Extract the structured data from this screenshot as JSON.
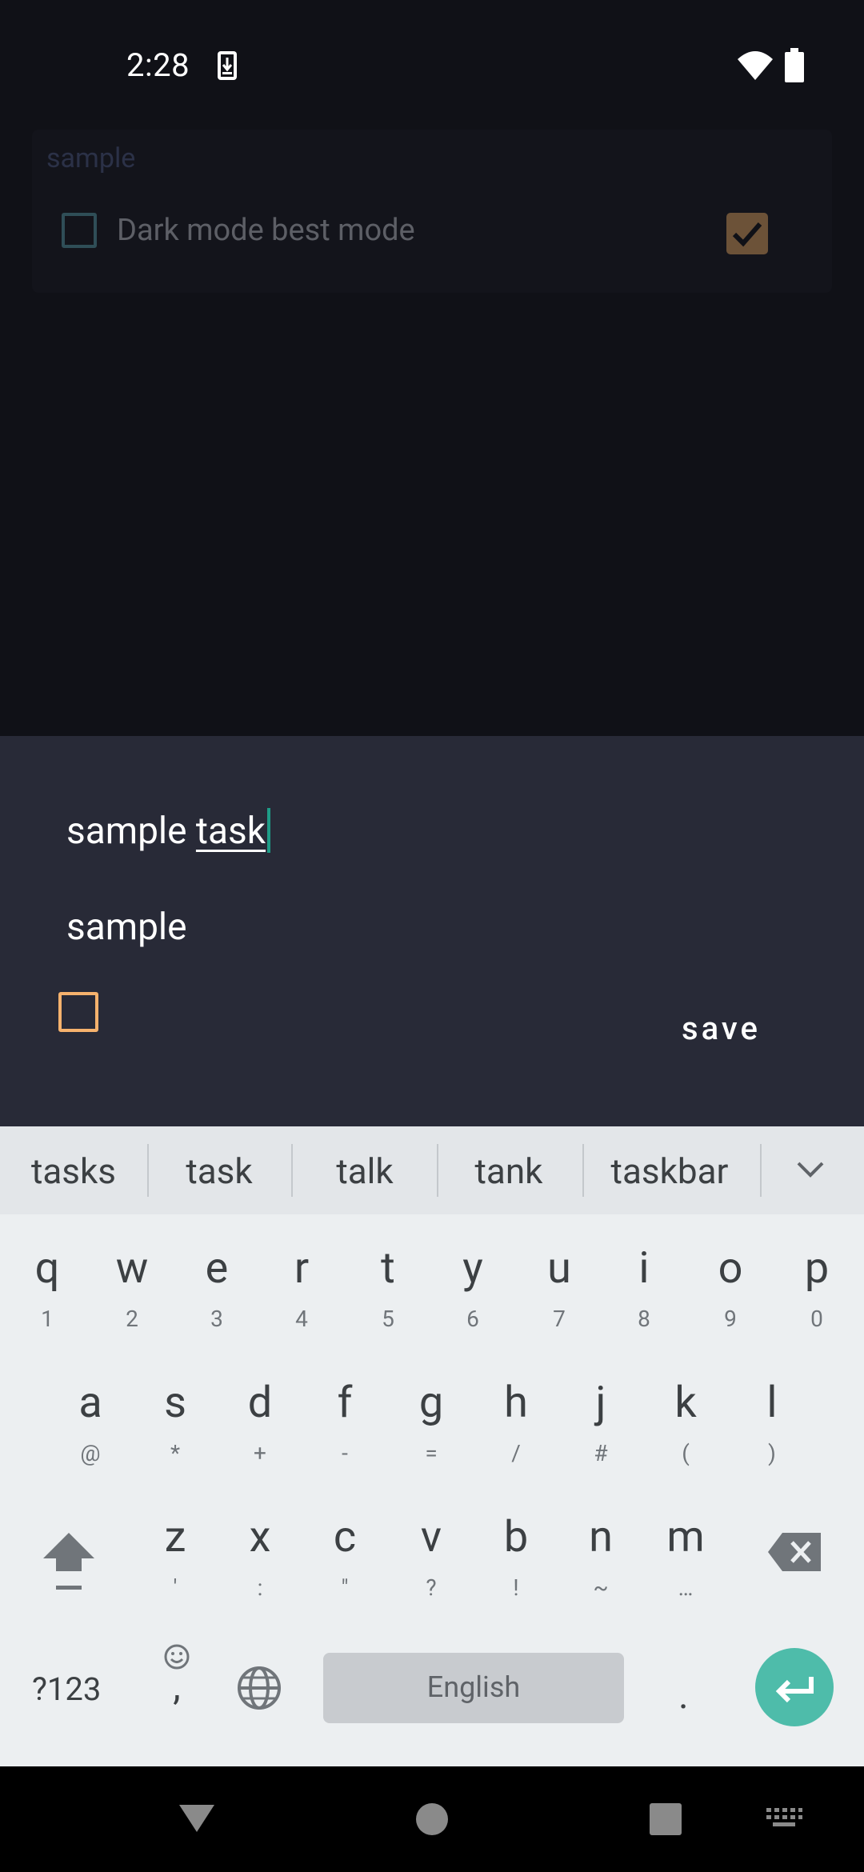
{
  "status_bar": {
    "time": "2:28"
  },
  "background_list": {
    "card_title": "sample",
    "item_label": "Dark mode best mode"
  },
  "dialog": {
    "title_prefix": "sample ",
    "title_suggested": "task",
    "category_value": "sample",
    "save_label": "save"
  },
  "keyboard": {
    "suggestions": [
      "tasks",
      "task",
      "talk",
      "tank",
      "taskbar"
    ],
    "row1": [
      {
        "k": "q",
        "s": "1"
      },
      {
        "k": "w",
        "s": "2"
      },
      {
        "k": "e",
        "s": "3"
      },
      {
        "k": "r",
        "s": "4"
      },
      {
        "k": "t",
        "s": "5"
      },
      {
        "k": "y",
        "s": "6"
      },
      {
        "k": "u",
        "s": "7"
      },
      {
        "k": "i",
        "s": "8"
      },
      {
        "k": "o",
        "s": "9"
      },
      {
        "k": "p",
        "s": "0"
      }
    ],
    "row2": [
      {
        "k": "a",
        "s": "@"
      },
      {
        "k": "s",
        "s": "*"
      },
      {
        "k": "d",
        "s": "+"
      },
      {
        "k": "f",
        "s": "-"
      },
      {
        "k": "g",
        "s": "="
      },
      {
        "k": "h",
        "s": "/"
      },
      {
        "k": "j",
        "s": "#"
      },
      {
        "k": "k",
        "s": "("
      },
      {
        "k": "l",
        "s": ")"
      }
    ],
    "row3": [
      {
        "k": "z",
        "s": "'"
      },
      {
        "k": "x",
        "s": ":"
      },
      {
        "k": "c",
        "s": "\""
      },
      {
        "k": "v",
        "s": "?"
      },
      {
        "k": "b",
        "s": "!"
      },
      {
        "k": "n",
        "s": "~"
      },
      {
        "k": "m",
        "s": "…"
      }
    ],
    "symbols_label": "?123",
    "comma_label": ",",
    "space_label": "English",
    "period_label": "."
  },
  "colors": {
    "accent": "#1e9c87",
    "checkbox_orange": "#f6b26d",
    "enter_key": "#4ebcaa"
  }
}
